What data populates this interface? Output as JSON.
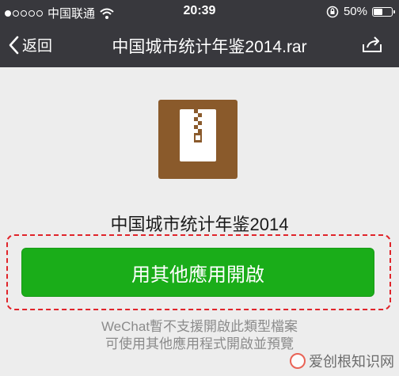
{
  "status_bar": {
    "carrier": "中国联通",
    "time": "20:39",
    "battery_percent": "50%",
    "battery_level": 0.5,
    "signal_icon": "signal-dots-icon",
    "wifi_icon": "wifi-icon",
    "rotation_lock_icon": "rotation-lock-icon"
  },
  "nav": {
    "back_label": "返回",
    "title": "中国城市统计年鉴2014.rar",
    "share_icon": "share-icon"
  },
  "file": {
    "icon": "zip-archive-icon",
    "icon_color": "#8a5a2b",
    "name": "中国城市统计年鉴2014"
  },
  "open_button": {
    "label": "用其他應用開啟",
    "color": "#1aad19"
  },
  "hint": {
    "line1": "WeChat暫不支援開啟此類型檔案",
    "line2": "可使用其他應用程式開啟並預覽"
  },
  "watermark": {
    "text": "爱创根知识网"
  }
}
